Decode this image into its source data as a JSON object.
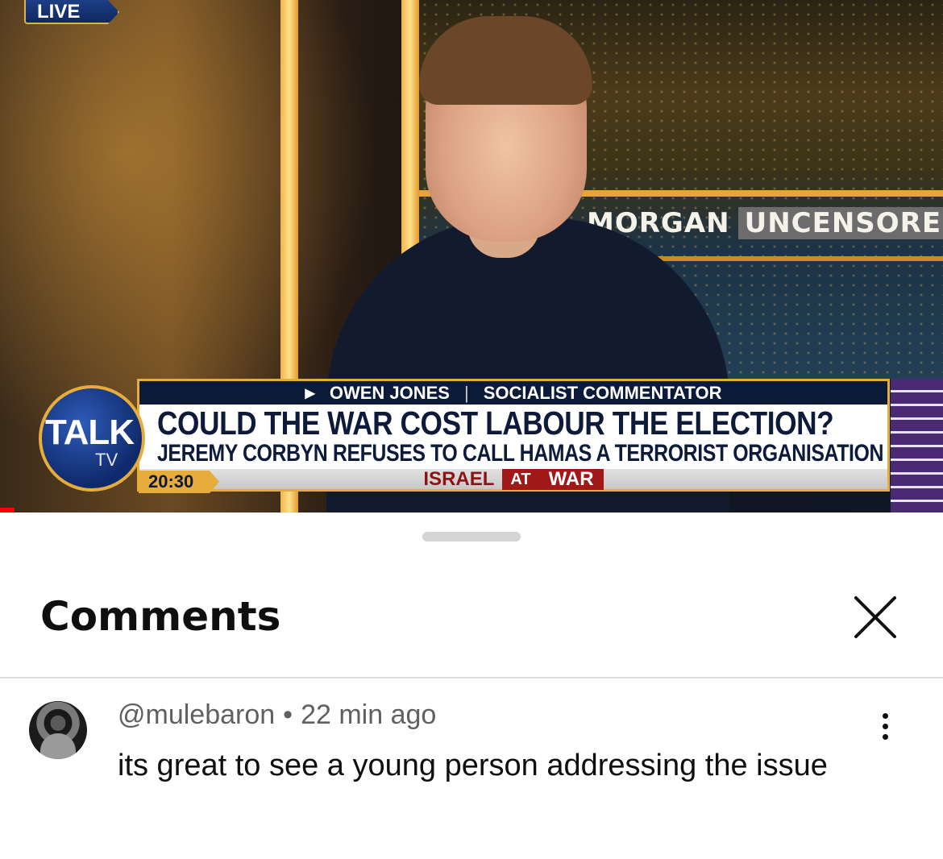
{
  "video": {
    "live_label": "LIVE",
    "studio_sign": {
      "word1": "MORGAN",
      "word2": "UNCENSORE"
    },
    "lower_third": {
      "guest_name": "OWEN JONES",
      "separator": "|",
      "guest_title": "SOCIALIST COMMENTATOR",
      "headline": "COULD THE WAR COST LABOUR THE ELECTION?",
      "subheadline": "JEREMY CORBYN REFUSES TO CALL HAMAS A TERRORIST ORGANISATION",
      "topic_part1": "ISRAEL",
      "topic_part2": "AT",
      "topic_part3": "WAR"
    },
    "channel_logo": {
      "word1": "TALK",
      "word2": "TV"
    },
    "time": "20:30",
    "progress_fraction": 0.015
  },
  "comments": {
    "title": "Comments",
    "close_icon": "close-icon",
    "items": [
      {
        "username": "@mulebaron",
        "separator": "•",
        "time": "22 min ago",
        "text": "its great to see a young person addressing the issue",
        "more_icon": "more-vertical-icon"
      }
    ]
  },
  "colors": {
    "accent_gold": "#e6ad3c",
    "navy": "#0c1a3a",
    "war_red": "#a01818",
    "progress_red": "#ff0000"
  }
}
